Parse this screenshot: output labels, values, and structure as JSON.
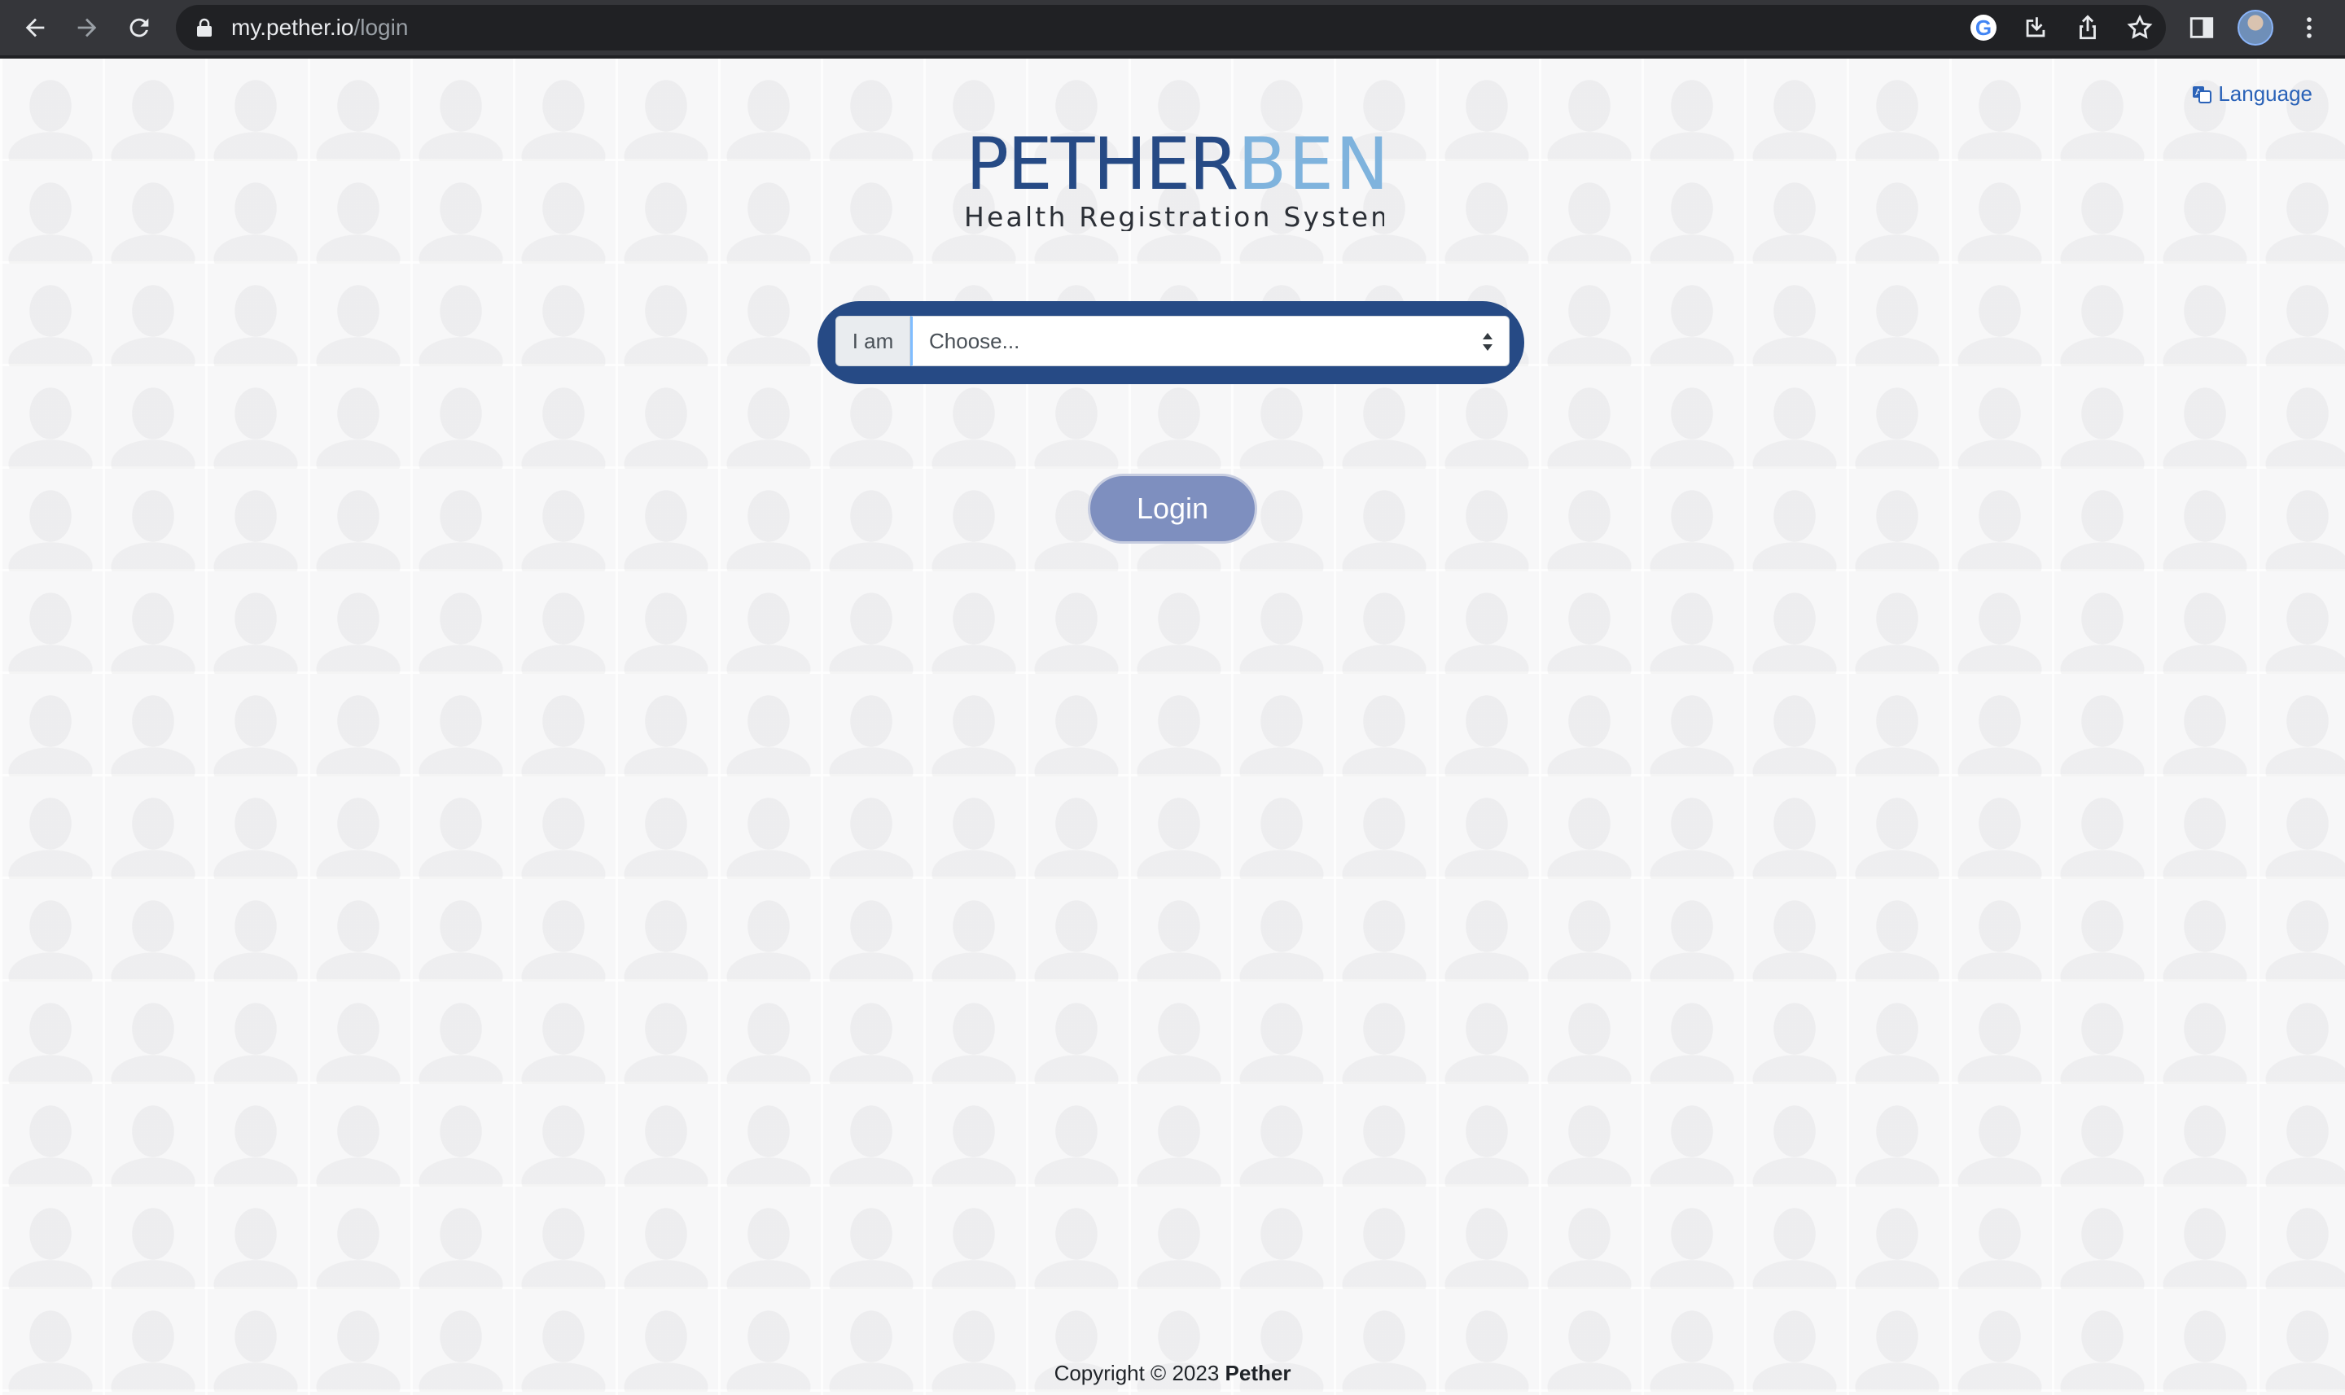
{
  "browser": {
    "url_host": "my.pether.io",
    "url_path": "/login"
  },
  "header": {
    "language_label": "Language"
  },
  "logo": {
    "brand_left": "PETHER",
    "brand_right": "BEN",
    "tagline": "Health Registration System",
    "colors": {
      "dark": "#264a85",
      "light": "#7fb3dd"
    }
  },
  "login_form": {
    "role_prefix": "I am",
    "role_select_value": "Choose...",
    "login_label": "Login"
  },
  "footer": {
    "copyright": "Copyright © 2023",
    "company": "Pether"
  },
  "colors": {
    "pill": "#264a85",
    "login_button": "#7e8fbf",
    "link": "#2a62b8"
  }
}
